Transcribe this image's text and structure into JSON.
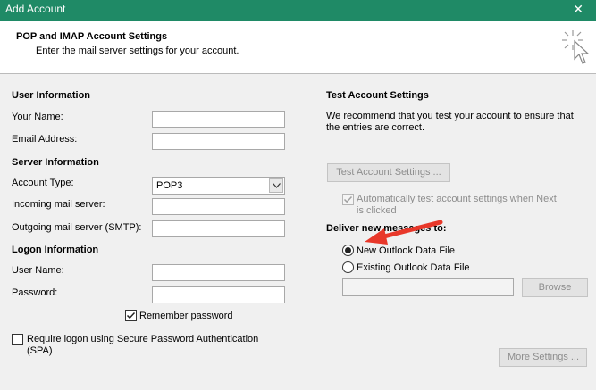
{
  "window": {
    "title": "Add Account",
    "close_label": "✕"
  },
  "header": {
    "title": "POP and IMAP Account Settings",
    "subtitle": "Enter the mail server settings for your account."
  },
  "left": {
    "user_info": "User Information",
    "your_name_label": "Your Name:",
    "email_label": "Email Address:",
    "server_info": "Server Information",
    "account_type_label": "Account Type:",
    "account_type_value": "POP3",
    "incoming_label": "Incoming mail server:",
    "outgoing_label": "Outgoing mail server (SMTP):",
    "logon_info": "Logon Information",
    "user_name_label": "User Name:",
    "password_label": "Password:",
    "remember_password": "Remember password",
    "remember_checked": true,
    "spa_line1": "Require logon using Secure Password Authentication",
    "spa_line2": "(SPA)",
    "spa_checked": false
  },
  "right": {
    "test_title": "Test Account Settings",
    "test_desc_line1": "We recommend that you test your account to ensure that",
    "test_desc_line2": "the entries are correct.",
    "test_button": "Test Account Settings ...",
    "auto_test_line1": "Automatically test account settings when Next",
    "auto_test_line2": "is clicked",
    "auto_test_checked": true,
    "deliver_title": "Deliver new messages to:",
    "new_file": "New Outlook Data File",
    "existing_file": "Existing Outlook Data File",
    "selected_option": "new_file",
    "browse_button": "Browse",
    "more_settings_button": "More Settings ..."
  },
  "colors": {
    "titlebar": "#1f8a66",
    "arrow": "#e8382a"
  }
}
